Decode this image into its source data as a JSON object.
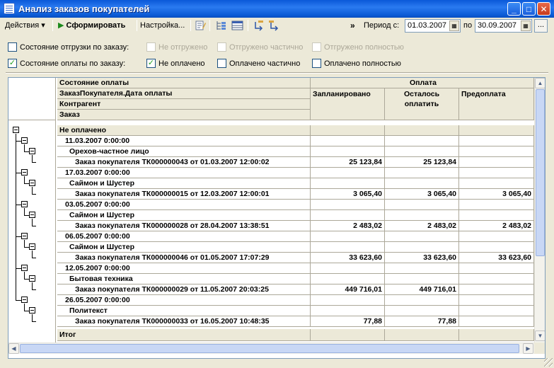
{
  "window": {
    "title": "Анализ заказов покупателей",
    "buttons": {
      "minimize": "_",
      "maximize": "□",
      "close": "✕"
    }
  },
  "toolbar": {
    "actions_label": "Действия ▾",
    "generate_label": "Сформировать",
    "settings_label": "Настройка...",
    "more_label": "»",
    "period_from_label": "Период с:",
    "period_from_value": "01.03.2007",
    "period_to_label": "по",
    "period_to_value": "30.09.2007",
    "ellipsis_label": "..."
  },
  "filters": {
    "shipment": {
      "label": "Состояние отгрузки по заказу:",
      "checked": false,
      "options": [
        {
          "label": "Не отгружено",
          "checked": false,
          "disabled": true
        },
        {
          "label": "Отгружено частично",
          "checked": false,
          "disabled": true
        },
        {
          "label": "Отгружено полностью",
          "checked": false,
          "disabled": true
        }
      ]
    },
    "payment": {
      "label": "Состояние оплаты по заказу:",
      "checked": true,
      "options": [
        {
          "label": "Не оплачено",
          "checked": true,
          "disabled": false
        },
        {
          "label": "Оплачено частично",
          "checked": false,
          "disabled": false
        },
        {
          "label": "Оплачено полностью",
          "checked": false,
          "disabled": false
        }
      ]
    }
  },
  "report": {
    "header": {
      "group_fields": [
        "Состояние оплаты",
        "ЗаказПокупателя.Дата оплаты",
        "Контрагент",
        "Заказ"
      ],
      "payment_group": "Оплата",
      "columns": [
        "Запланировано",
        "Осталось оплатить",
        "Предоплата"
      ]
    },
    "rows": [
      {
        "level": 0,
        "label": "Не оплачено",
        "planned": "",
        "remaining": "",
        "prepaid": ""
      },
      {
        "level": 1,
        "label": "11.03.2007 0:00:00",
        "planned": "",
        "remaining": "",
        "prepaid": ""
      },
      {
        "level": 2,
        "label": "Орехов-частное лицо",
        "planned": "",
        "remaining": "",
        "prepaid": ""
      },
      {
        "level": 3,
        "label": "Заказ покупателя ТК000000043 от 01.03.2007 12:00:02",
        "planned": "25 123,84",
        "remaining": "25 123,84",
        "prepaid": ""
      },
      {
        "level": 1,
        "label": "17.03.2007 0:00:00",
        "planned": "",
        "remaining": "",
        "prepaid": ""
      },
      {
        "level": 2,
        "label": "Саймон и Шустер",
        "planned": "",
        "remaining": "",
        "prepaid": ""
      },
      {
        "level": 3,
        "label": "Заказ покупателя ТК000000015 от 12.03.2007 12:00:01",
        "planned": "3 065,40",
        "remaining": "3 065,40",
        "prepaid": "3 065,40"
      },
      {
        "level": 1,
        "label": "03.05.2007 0:00:00",
        "planned": "",
        "remaining": "",
        "prepaid": ""
      },
      {
        "level": 2,
        "label": "Саймон и Шустер",
        "planned": "",
        "remaining": "",
        "prepaid": ""
      },
      {
        "level": 3,
        "label": "Заказ покупателя ТК000000028 от 28.04.2007 13:38:51",
        "planned": "2 483,02",
        "remaining": "2 483,02",
        "prepaid": "2 483,02"
      },
      {
        "level": 1,
        "label": "06.05.2007 0:00:00",
        "planned": "",
        "remaining": "",
        "prepaid": ""
      },
      {
        "level": 2,
        "label": "Саймон и Шустер",
        "planned": "",
        "remaining": "",
        "prepaid": ""
      },
      {
        "level": 3,
        "label": "Заказ покупателя ТК000000046 от 01.05.2007 17:07:29",
        "planned": "33 623,60",
        "remaining": "33 623,60",
        "prepaid": "33 623,60"
      },
      {
        "level": 1,
        "label": "12.05.2007 0:00:00",
        "planned": "",
        "remaining": "",
        "prepaid": ""
      },
      {
        "level": 2,
        "label": "Бытовая техника",
        "planned": "",
        "remaining": "",
        "prepaid": ""
      },
      {
        "level": 3,
        "label": "Заказ покупателя ТК000000029 от 11.05.2007 20:03:25",
        "planned": "449 716,01",
        "remaining": "449 716,01",
        "prepaid": ""
      },
      {
        "level": 1,
        "label": "26.05.2007 0:00:00",
        "planned": "",
        "remaining": "",
        "prepaid": ""
      },
      {
        "level": 2,
        "label": "Политекст",
        "planned": "",
        "remaining": "",
        "prepaid": ""
      },
      {
        "level": 3,
        "label": "Заказ покупателя ТК000000033 от 16.05.2007 10:48:35",
        "planned": "77,88",
        "remaining": "77,88",
        "prepaid": ""
      }
    ],
    "total_label": "Итог"
  }
}
